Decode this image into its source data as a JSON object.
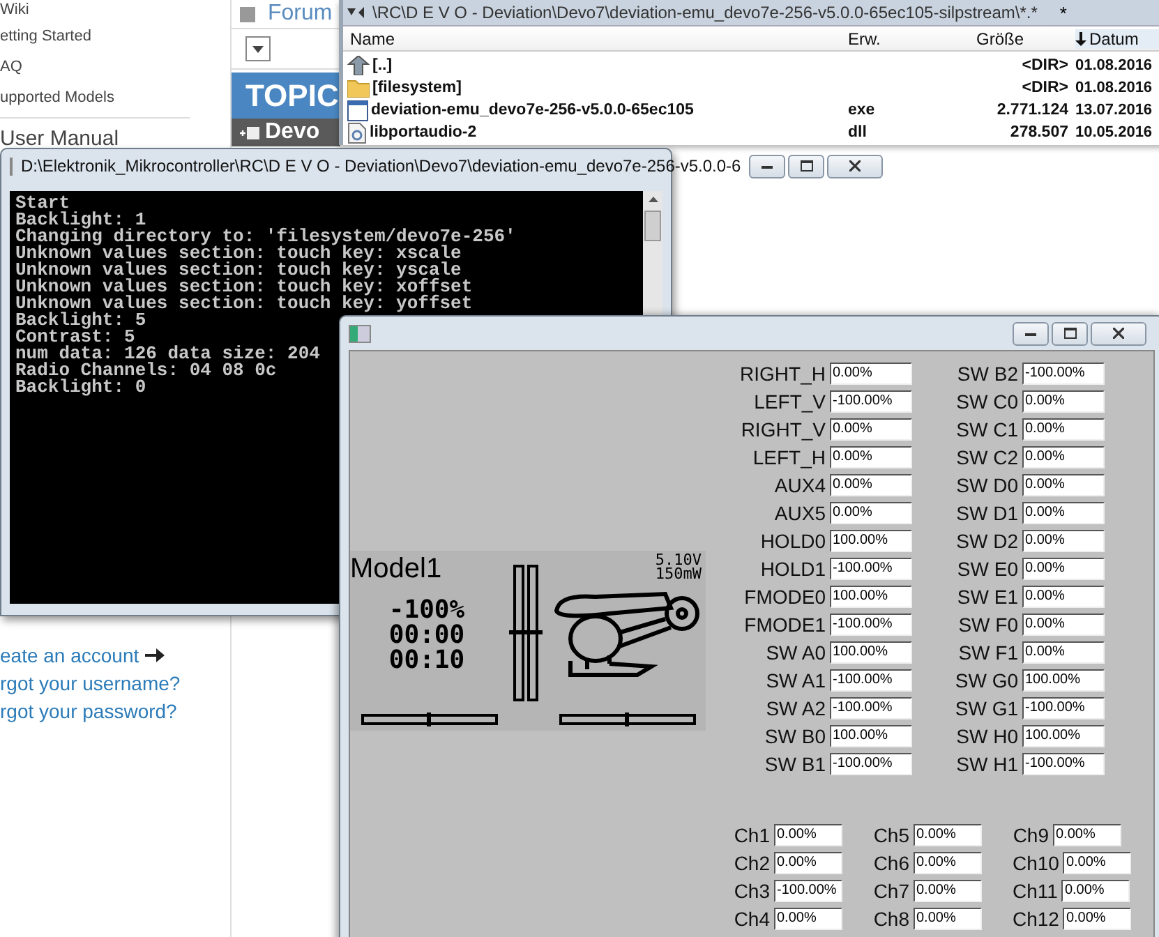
{
  "web_page": {
    "sidebar_links": [
      "Wiki",
      "etting Started",
      "AQ",
      "upported Models"
    ],
    "section_heading": "User Manual",
    "account_links": [
      {
        "text": "eate an account",
        "arrow": true
      },
      {
        "text": "rgot your username?",
        "arrow": false
      },
      {
        "text": "rgot your password?",
        "arrow": false
      }
    ],
    "forum_tab": "Forum",
    "topics_header": "TOPIC",
    "topic_row": "Devo"
  },
  "file_manager": {
    "path": "\\RC\\D E V O - Deviation\\Devo7\\deviation-emu_devo7e-256-v5.0.0-65ec105-silpstream\\*.*",
    "tab_marker": "*",
    "columns": [
      "Name",
      "Erw.",
      "Größe",
      "Datum"
    ],
    "rows": [
      {
        "kind": "up",
        "name": "[..]",
        "size": "<DIR>",
        "date": "01.08.2016"
      },
      {
        "kind": "folder",
        "name": "[filesystem]",
        "size": "<DIR>",
        "date": "01.08.2016"
      },
      {
        "kind": "program",
        "name": "deviation-emu_devo7e-256-v5.0.0-65ec105",
        "ext": "exe",
        "size": "2.771.124",
        "date": "13.07.2016"
      },
      {
        "kind": "library",
        "name": "libportaudio-2",
        "ext": "dll",
        "size": "278.507",
        "date": "10.05.2016"
      }
    ]
  },
  "console": {
    "title": "D:\\Elektronik_Mikrocontroller\\RC\\D E V O - Deviation\\Devo7\\deviation-emu_devo7e-256-v5.0.0-6",
    "lines": [
      "Start",
      "Backlight: 1",
      "Changing directory to: 'filesystem/devo7e-256'",
      "Unknown values section: touch key: xscale",
      "Unknown values section: touch key: yscale",
      "Unknown values section: touch key: xoffset",
      "Unknown values section: touch key: yoffset",
      "Backlight: 5",
      "Contrast: 5",
      "num data: 126 data size: 204",
      "Radio Channels: 04 08 0c",
      "Backlight: 0"
    ]
  },
  "emulator": {
    "lcd": {
      "model": "Model1",
      "voltage": "5.10V",
      "power": "150mW",
      "throttle": "-100%",
      "timers": [
        "00:00",
        "00:10"
      ]
    },
    "inputs_left": [
      {
        "label": "RIGHT_H",
        "value": "0.00%"
      },
      {
        "label": "LEFT_V",
        "value": "-100.00%"
      },
      {
        "label": "RIGHT_V",
        "value": "0.00%"
      },
      {
        "label": "LEFT_H",
        "value": "0.00%"
      },
      {
        "label": "AUX4",
        "value": "0.00%"
      },
      {
        "label": "AUX5",
        "value": "0.00%"
      },
      {
        "label": "HOLD0",
        "value": "100.00%"
      },
      {
        "label": "HOLD1",
        "value": "-100.00%"
      },
      {
        "label": "FMODE0",
        "value": "100.00%"
      },
      {
        "label": "FMODE1",
        "value": "-100.00%"
      },
      {
        "label": "SW A0",
        "value": "100.00%"
      },
      {
        "label": "SW A1",
        "value": "-100.00%"
      },
      {
        "label": "SW A2",
        "value": "-100.00%"
      },
      {
        "label": "SW B0",
        "value": "100.00%"
      },
      {
        "label": "SW B1",
        "value": "-100.00%"
      }
    ],
    "inputs_right": [
      {
        "label": "SW B2",
        "value": "-100.00%"
      },
      {
        "label": "SW C0",
        "value": "0.00%"
      },
      {
        "label": "SW C1",
        "value": "0.00%"
      },
      {
        "label": "SW C2",
        "value": "0.00%"
      },
      {
        "label": "SW D0",
        "value": "0.00%"
      },
      {
        "label": "SW D1",
        "value": "0.00%"
      },
      {
        "label": "SW D2",
        "value": "0.00%"
      },
      {
        "label": "SW E0",
        "value": "0.00%"
      },
      {
        "label": "SW E1",
        "value": "0.00%"
      },
      {
        "label": "SW F0",
        "value": "0.00%"
      },
      {
        "label": "SW F1",
        "value": "0.00%"
      },
      {
        "label": "SW G0",
        "value": "100.00%"
      },
      {
        "label": "SW G1",
        "value": "-100.00%"
      },
      {
        "label": "SW H0",
        "value": "100.00%"
      },
      {
        "label": "SW H1",
        "value": "-100.00%"
      }
    ],
    "channel_columns": [
      [
        {
          "label": "Ch1",
          "value": "0.00%"
        },
        {
          "label": "Ch2",
          "value": "0.00%"
        },
        {
          "label": "Ch3",
          "value": "-100.00%"
        },
        {
          "label": "Ch4",
          "value": "0.00%"
        }
      ],
      [
        {
          "label": "Ch5",
          "value": "0.00%"
        },
        {
          "label": "Ch6",
          "value": "0.00%"
        },
        {
          "label": "Ch7",
          "value": "0.00%"
        },
        {
          "label": "Ch8",
          "value": "0.00%"
        }
      ],
      [
        {
          "label": "Ch9",
          "value": "0.00%"
        },
        {
          "label": "Ch10",
          "value": "0.00%"
        },
        {
          "label": "Ch11",
          "value": "0.00%"
        },
        {
          "label": "Ch12",
          "value": "0.00%"
        }
      ]
    ]
  }
}
